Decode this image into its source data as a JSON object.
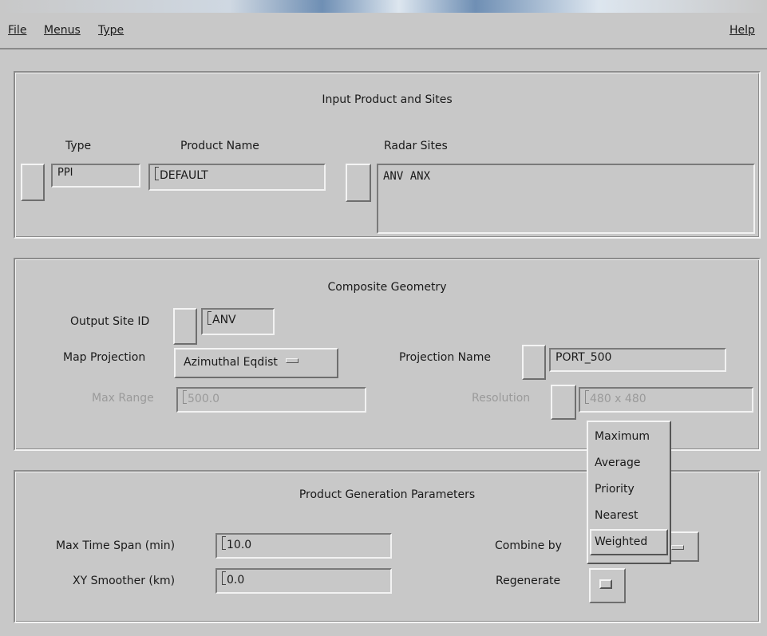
{
  "menubar": {
    "file": "File",
    "menus": "Menus",
    "type": "Type",
    "help": "Help"
  },
  "input_section": {
    "title": "Input Product and Sites",
    "type_label": "Type",
    "type_value": "PPI",
    "product_name_label": "Product Name",
    "product_name_value": "DEFAULT",
    "radar_sites_label": "Radar Sites",
    "radar_sites_value": "ANV ANX"
  },
  "geometry_section": {
    "title": "Composite Geometry",
    "output_site_label": "Output Site ID",
    "output_site_value": "ANV",
    "map_projection_label": "Map Projection",
    "map_projection_value": "Azimuthal Eqdist",
    "projection_name_label": "Projection Name",
    "projection_name_value": "PORT_500",
    "max_range_label": "Max Range",
    "max_range_value": "500.0",
    "resolution_label": "Resolution",
    "resolution_value": "480 x 480"
  },
  "params_section": {
    "title": "Product Generation Parameters",
    "max_time_label": "Max Time Span (min)",
    "max_time_value": "10.0",
    "smoother_label": "XY Smoother (km)",
    "smoother_value": "0.0",
    "combine_label": "Combine by",
    "regenerate_label": "Regenerate"
  },
  "combine_popup": {
    "options": [
      "Maximum",
      "Average",
      "Priority",
      "Nearest",
      "Weighted"
    ],
    "selected": "Weighted"
  }
}
